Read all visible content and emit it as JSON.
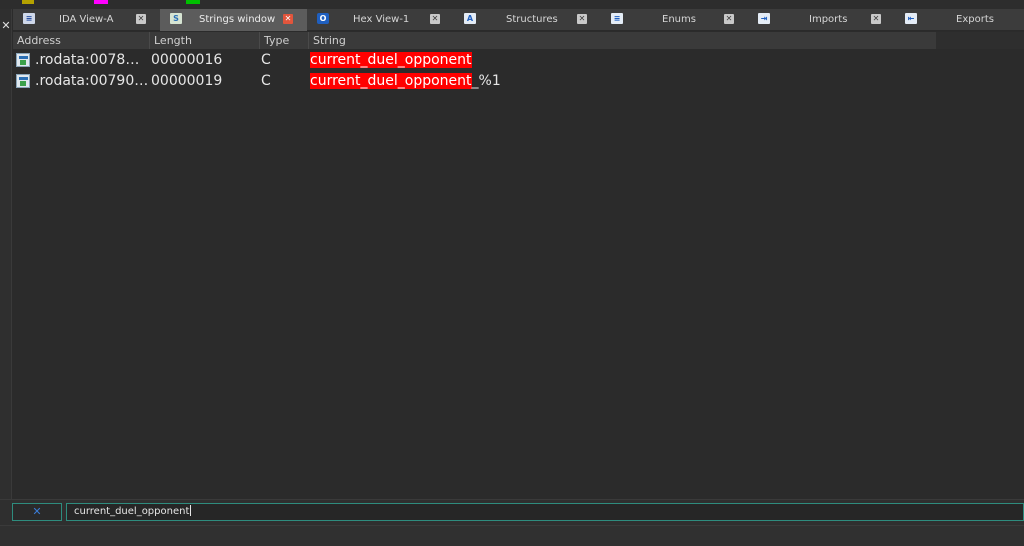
{
  "colors": {
    "highlight": "#ff0000",
    "legend_swatches": [
      "#b5a200",
      "#ff00ff",
      "#00c000"
    ]
  },
  "tabs": [
    {
      "label": "IDA View-A",
      "icon": "disassembly-icon",
      "active": false
    },
    {
      "label": "Strings window",
      "icon": "strings-icon",
      "active": true
    },
    {
      "label": "Hex View-1",
      "icon": "hex-icon",
      "active": false
    },
    {
      "label": "Structures",
      "icon": "structures-icon",
      "active": false
    },
    {
      "label": "Enums",
      "icon": "enums-icon",
      "active": false
    },
    {
      "label": "Imports",
      "icon": "imports-icon",
      "active": false
    },
    {
      "label": "Exports",
      "icon": "exports-icon",
      "active": false
    }
  ],
  "table": {
    "columns": [
      "Address",
      "Length",
      "Type",
      "String"
    ],
    "rows": [
      {
        "address": ".rodata:0078…",
        "length": "00000016",
        "type": "C",
        "string_match": "current_duel_opponent",
        "string_rest": ""
      },
      {
        "address": ".rodata:00790…",
        "length": "00000019",
        "type": "C",
        "string_match": "current_duel_opponent",
        "string_rest": "_%1"
      }
    ]
  },
  "search": {
    "value": "current_duel_opponent",
    "clear_icon": "clear-filter-icon"
  }
}
